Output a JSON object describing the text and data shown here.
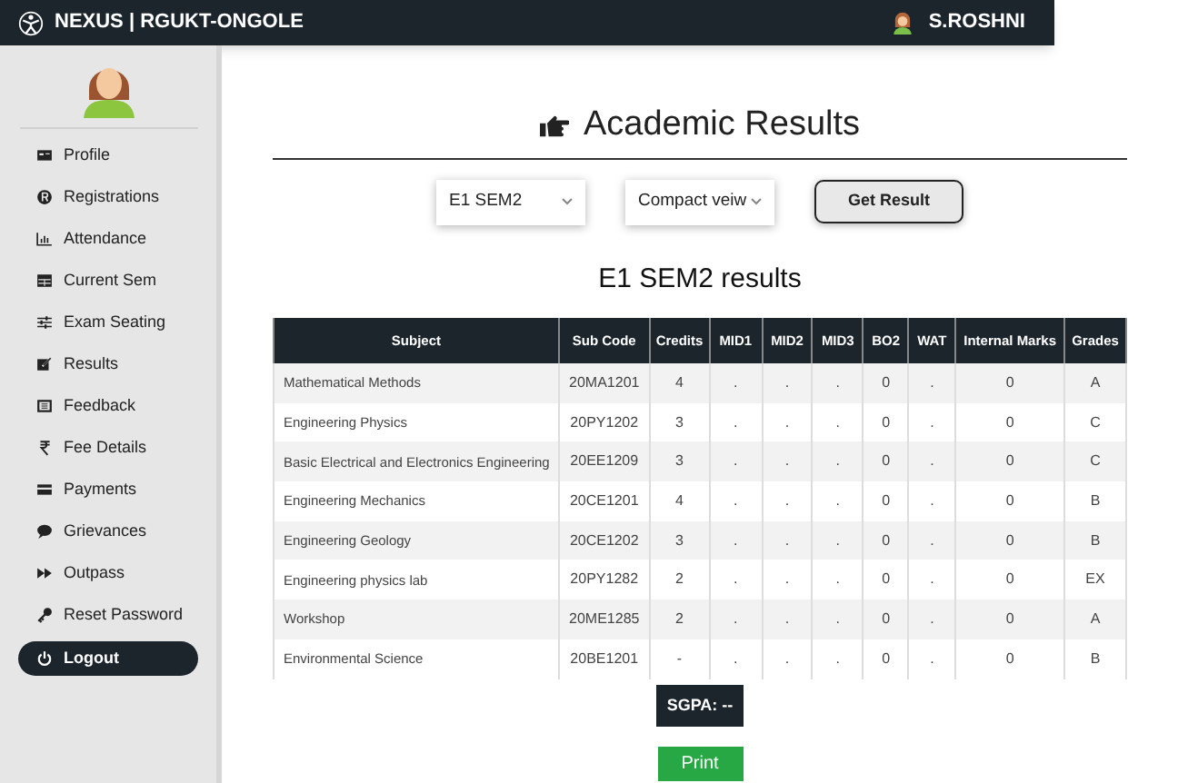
{
  "header": {
    "brand": "NEXUS | RGUKT-ONGOLE",
    "user": "S.ROSHNI"
  },
  "sidebar": {
    "items": [
      {
        "label": "Profile",
        "selected": false
      },
      {
        "label": "Registrations",
        "selected": false
      },
      {
        "label": "Attendance",
        "selected": false
      },
      {
        "label": "Current Sem",
        "selected": false
      },
      {
        "label": "Exam Seating",
        "selected": false
      },
      {
        "label": "Results",
        "selected": false
      },
      {
        "label": "Feedback",
        "selected": false
      },
      {
        "label": "Fee Details",
        "selected": false
      },
      {
        "label": "Payments",
        "selected": false
      },
      {
        "label": "Grievances",
        "selected": false
      },
      {
        "label": "Outpass",
        "selected": false
      },
      {
        "label": "Reset Password",
        "selected": false
      },
      {
        "label": "Logout",
        "selected": true
      }
    ]
  },
  "main": {
    "title": "Academic Results",
    "semester_select": {
      "value": "E1 SEM2"
    },
    "view_select": {
      "value": "Compact veiw"
    },
    "get_button": "Get Result",
    "results_heading": "E1 SEM2 results",
    "table": {
      "columns": [
        "Subject",
        "Sub Code",
        "Credits",
        "MID1",
        "MID2",
        "MID3",
        "BO2",
        "WAT",
        "Internal Marks",
        "Grades"
      ],
      "rows": [
        [
          "Mathematical Methods",
          "20MA1201",
          "4",
          ".",
          ".",
          ".",
          "0",
          ".",
          "0",
          "A"
        ],
        [
          "Engineering Physics",
          "20PY1202",
          "3",
          ".",
          ".",
          ".",
          "0",
          ".",
          "0",
          "C"
        ],
        [
          "Basic Electrical and Electronics Engineering",
          "20EE1209",
          "3",
          ".",
          ".",
          ".",
          "0",
          ".",
          "0",
          "C"
        ],
        [
          "Engineering Mechanics",
          "20CE1201",
          "4",
          ".",
          ".",
          ".",
          "0",
          ".",
          "0",
          "B"
        ],
        [
          "Engineering Geology",
          "20CE1202",
          "3",
          ".",
          ".",
          ".",
          "0",
          ".",
          "0",
          "B"
        ],
        [
          "Engineering physics lab",
          "20PY1282",
          "2",
          ".",
          ".",
          ".",
          "0",
          ".",
          "0",
          "EX"
        ],
        [
          "Workshop",
          "20ME1285",
          "2",
          ".",
          ".",
          ".",
          "0",
          ".",
          "0",
          "A"
        ],
        [
          "Environmental Science",
          "20BE1201",
          "-",
          ".",
          ".",
          ".",
          "0",
          ".",
          "0",
          "B"
        ]
      ]
    },
    "sgpa": "SGPA: --",
    "print_button": "Print"
  }
}
